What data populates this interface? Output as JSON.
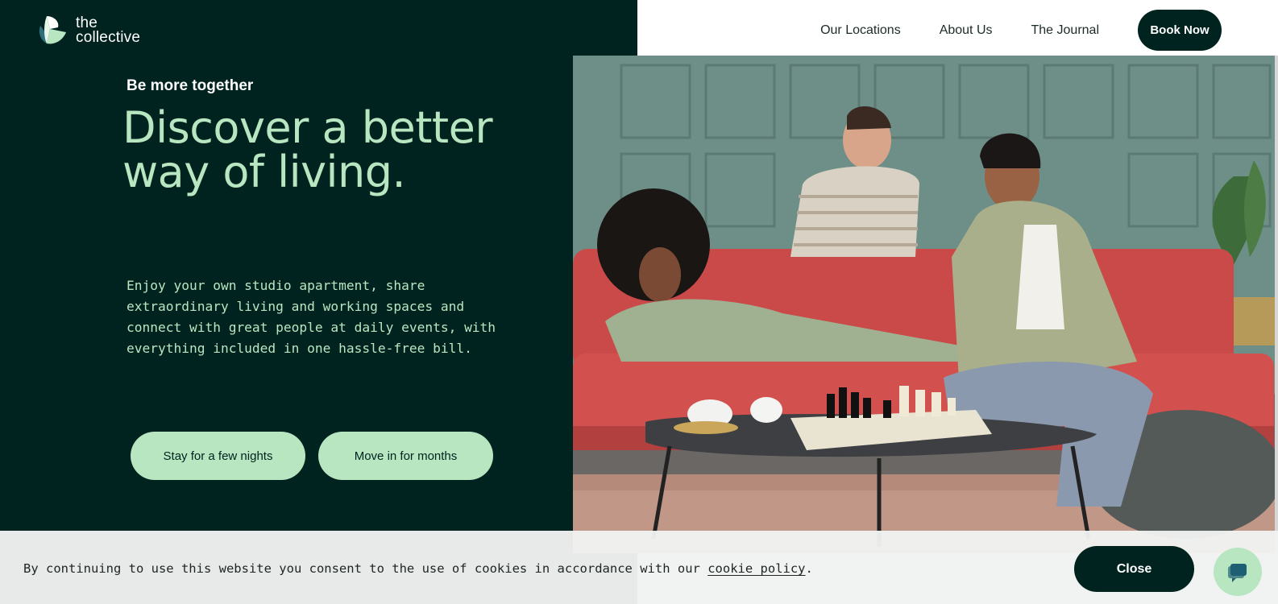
{
  "brand": {
    "logo_line1": "the",
    "logo_line2": "collective"
  },
  "nav": {
    "items": [
      "Our Locations",
      "About Us",
      "The Journal"
    ],
    "book_label": "Book Now"
  },
  "hero": {
    "kicker": "Be more together",
    "headline": "Discover a better way of living.",
    "intro": "Enjoy your own studio apartment, share extraordinary living and working spaces and connect with great people at daily events, with everything included in one hassle-free bill.",
    "cta_stay": "Stay for a few nights",
    "cta_move": "Move in for months"
  },
  "cookie": {
    "text": "By continuing to use this website you consent to the use of cookies in accordance with our ",
    "link": "cookie policy",
    "period": ".",
    "close_label": "Close"
  },
  "colors": {
    "dark_green": "#00231f",
    "mint": "#b8e6c1",
    "wall": "#6c8e86",
    "sofa": "#d2504e"
  }
}
